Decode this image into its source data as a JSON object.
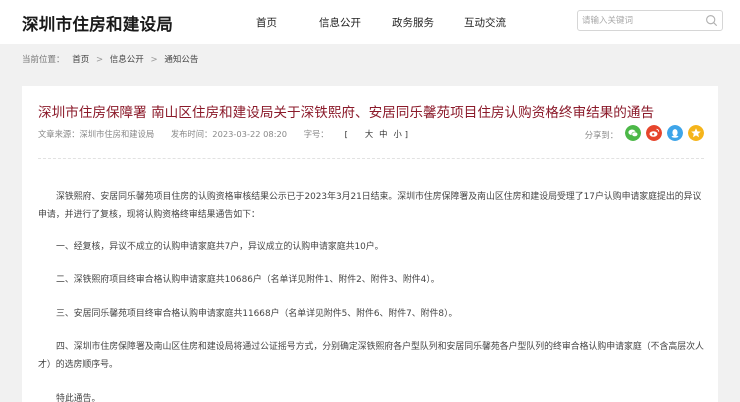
{
  "header": {
    "site_title": "深圳市住房和建设局",
    "nav": [
      {
        "label": "首页"
      },
      {
        "label": "信息公开"
      },
      {
        "label": "政务服务"
      },
      {
        "label": "互动交流"
      }
    ],
    "search": {
      "placeholder": "请输入关键词",
      "icon": "search-icon"
    }
  },
  "breadcrumb": {
    "label": "当前位置：",
    "items": [
      {
        "label": "首页"
      },
      {
        "label": "信息公开"
      },
      {
        "label": "通知公告"
      }
    ],
    "separator": ">"
  },
  "article": {
    "title": "深圳市住房保障署 南山区住房和建设局关于深铁熙府、安居同乐馨苑项目住房认购资格终审结果的通告",
    "meta": {
      "source": "文章来源：深圳市住房和建设局",
      "time": "发布时间：2023-03-22 08:20",
      "fontsize_label": "字号：",
      "fontsize_open": "[",
      "fontsize_options": [
        "大",
        "中",
        "小"
      ],
      "fontsize_close": "]"
    },
    "share": {
      "label": "分享到：",
      "icons": [
        {
          "name": "wechat-icon",
          "color": "#4cb848"
        },
        {
          "name": "weibo-icon",
          "color": "#e6452c"
        },
        {
          "name": "qq-icon",
          "color": "#3ea5e9"
        },
        {
          "name": "qzone-icon",
          "color": "#f5b41a"
        }
      ]
    },
    "paragraphs": [
      "深铁熙府、安居同乐馨苑项目住房的认购资格审核结果公示已于2023年3月21日结束。深圳市住房保障署及南山区住房和建设局受理了17户认购申请家庭提出的异议申请，并进行了复核，现将认购资格终审结果通告如下：",
      "一、经复核，异议不成立的认购申请家庭共7户，异议成立的认购申请家庭共10户。",
      "二、深铁熙府项目终审合格认购申请家庭共10686户（名单详见附件1、附件2、附件3、附件4）。",
      "三、安居同乐馨苑项目终审合格认购申请家庭共11668户（名单详见附件5、附件6、附件7、附件8）。",
      "四、深圳市住房保障署及南山区住房和建设局将通过公证摇号方式，分别确定深铁熙府各户型队列和安居同乐馨苑各户型队列的终审合格认购申请家庭（不含高层次人才）的选房顺序号。",
      "特此通告。"
    ]
  }
}
